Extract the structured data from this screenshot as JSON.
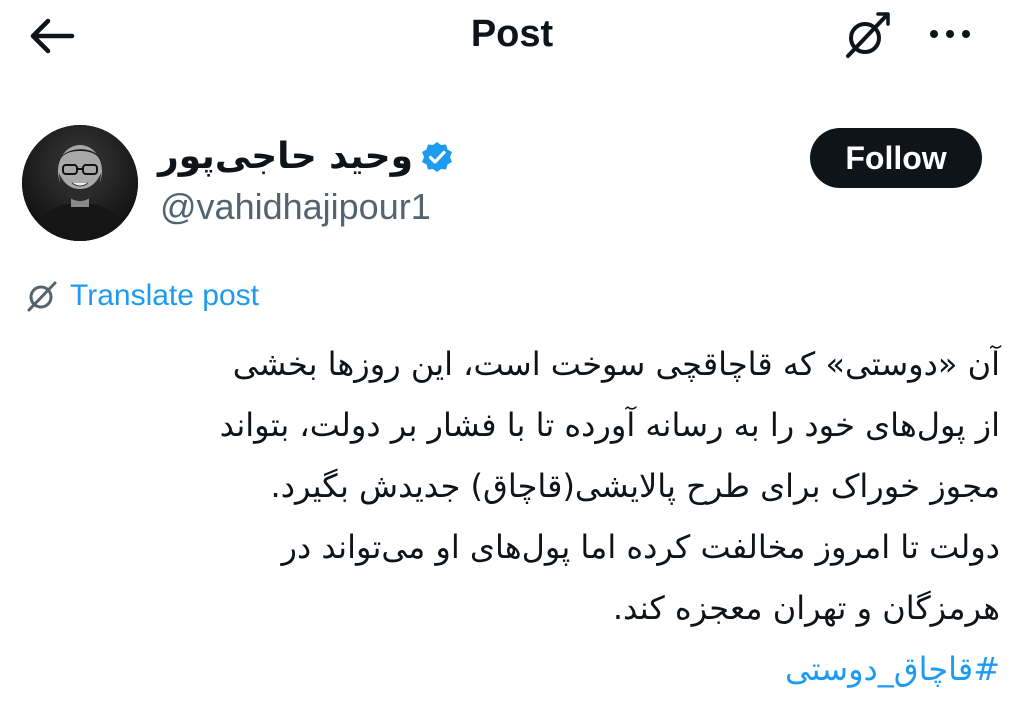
{
  "header": {
    "title": "Post",
    "back_icon": "arrow-left-icon",
    "translate_icon": "translate-globe-icon",
    "more_icon": "more-horizontal-icon"
  },
  "author": {
    "name": "وحید حاجی‌پور",
    "handle": "@vahidhajipour1",
    "verified": true,
    "verified_color": "#1d9bf0"
  },
  "follow_button": {
    "label": "Follow"
  },
  "translate": {
    "label": "Translate post",
    "icon": "translate-globe-icon",
    "color": "#1d9bf0"
  },
  "post": {
    "lines": [
      "آن «دوستی» که قاچاقچی سوخت است، این روزها بخشی",
      "از پول‌های خود را به رسانه آورده تا با فشار بر دولت، بتواند",
      "مجوز خوراک برای طرح پالایشی(قاچاق) جدیدش بگیرد.",
      "دولت تا امروز مخالفت کرده اما پول‌های او می‌تواند در",
      "هرمزگان و تهران معجزه کند."
    ],
    "hashtag": "#قاچاق_دوستی"
  }
}
